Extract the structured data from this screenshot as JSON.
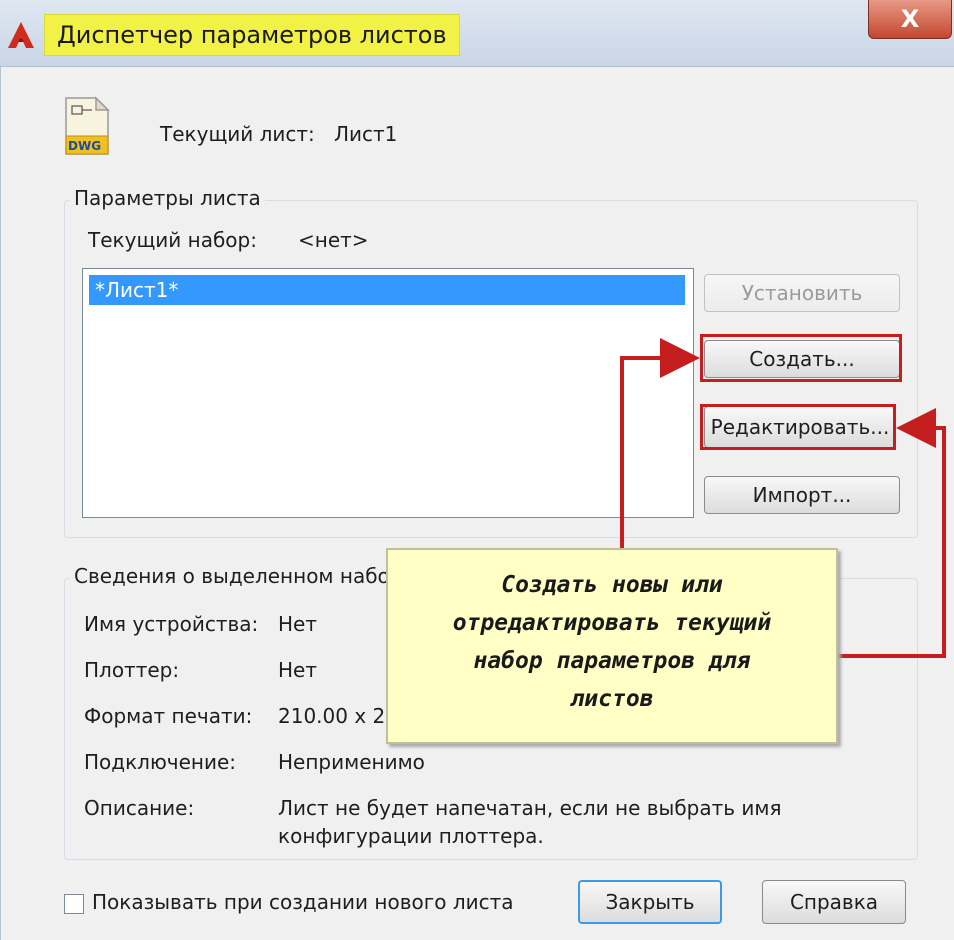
{
  "window": {
    "title": "Диспетчер параметров листов",
    "close_label": "X"
  },
  "current_sheet": {
    "label": "Текущий лист:",
    "value": "Лист1",
    "icon": "dwg-file-icon",
    "icon_text": "DWG"
  },
  "page_setups": {
    "group_label": "Параметры листа",
    "current_set_label": "Текущий набор:",
    "current_set_value": "<нет>",
    "items": [
      "*Лист1*"
    ],
    "buttons": {
      "set_current": "Установить",
      "new": "Создать...",
      "modify": "Редактировать...",
      "import": "Импорт..."
    }
  },
  "details": {
    "group_label": "Сведения о выделенном наборе",
    "rows": [
      {
        "label": "Имя устройства:",
        "value": "Нет"
      },
      {
        "label": "Плоттер:",
        "value": "Нет"
      },
      {
        "label": "Формат печати:",
        "value": "210.00 x 29"
      },
      {
        "label": "Подключение:",
        "value": "Неприменимо"
      },
      {
        "label": "Описание:",
        "value": "Лист не будет напечатан, если не выбрать имя"
      }
    ],
    "description_line2": "конфигурации плоттера."
  },
  "callout": {
    "lines": [
      "Создать новы или",
      "отредактировать текущий",
      "набор параметров для",
      "листов"
    ]
  },
  "footer": {
    "checkbox_label": "Показывать при создании нового листа",
    "checkbox_checked": false,
    "close_button": "Закрыть",
    "help_button": "Справка"
  },
  "colors": {
    "highlight": "#c41e1e",
    "selection": "#3399ff",
    "callout_bg": "#ffffc6",
    "title_highlight": "#f2f246"
  }
}
